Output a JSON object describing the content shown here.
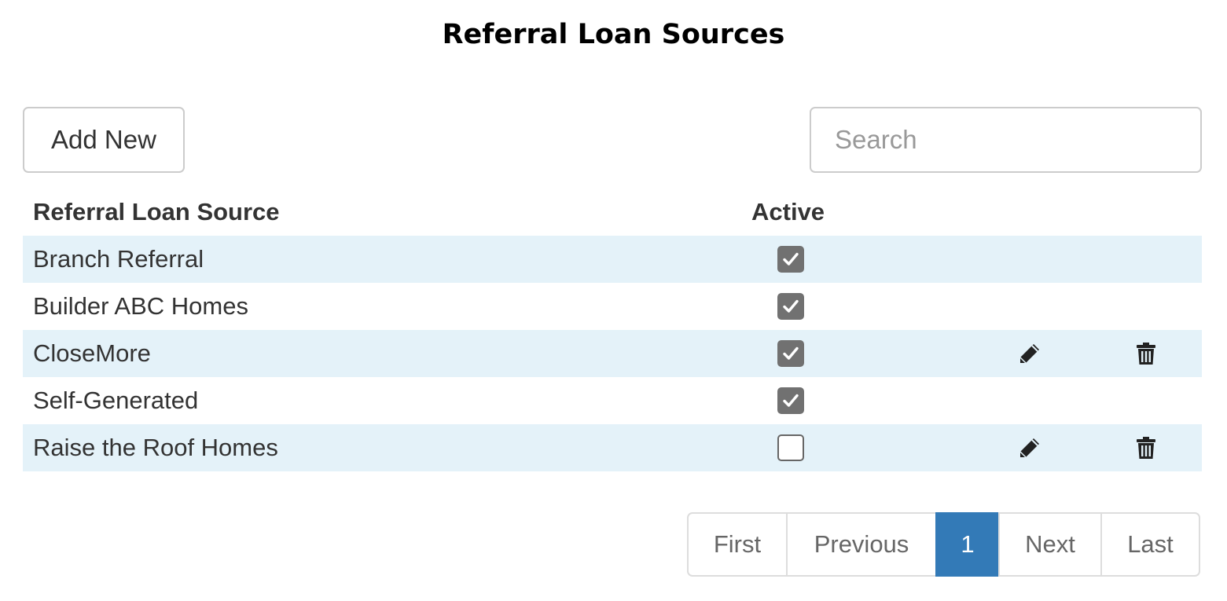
{
  "page": {
    "title": "Referral Loan Sources"
  },
  "toolbar": {
    "add_label": "Add New",
    "search_placeholder": "Search",
    "search_value": ""
  },
  "table": {
    "headers": {
      "name": "Referral Loan Source",
      "active": "Active"
    },
    "rows": [
      {
        "name": "Branch Referral",
        "active": true,
        "editable": false,
        "deletable": false
      },
      {
        "name": "Builder ABC Homes",
        "active": true,
        "editable": false,
        "deletable": false
      },
      {
        "name": "CloseMore",
        "active": true,
        "editable": true,
        "deletable": true
      },
      {
        "name": "Self-Generated",
        "active": true,
        "editable": false,
        "deletable": false
      },
      {
        "name": "Raise the Roof Homes",
        "active": false,
        "editable": true,
        "deletable": true
      }
    ]
  },
  "pagination": {
    "first": "First",
    "previous": "Previous",
    "current": "1",
    "next": "Next",
    "last": "Last"
  },
  "icons": {
    "edit": "pencil-icon",
    "delete": "trash-icon",
    "check": "checkmark-icon"
  },
  "colors": {
    "stripe": "#e4f2f9",
    "accent": "#337ab7",
    "checkbox": "#717171"
  }
}
